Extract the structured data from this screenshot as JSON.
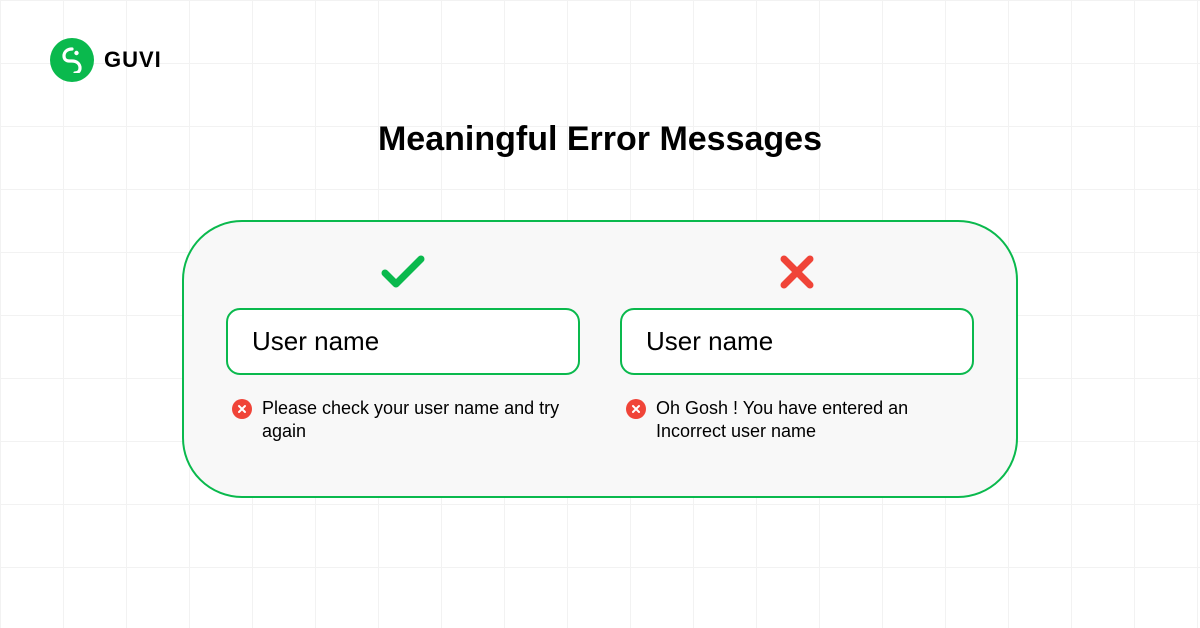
{
  "brand": {
    "name": "GUVI"
  },
  "title": "Meaningful Error Messages",
  "good": {
    "field_text": "User name",
    "error_text": "Please check your user name and try again"
  },
  "bad": {
    "field_text": "User name",
    "error_text": "Oh Gosh ! You have entered an Incorrect user name"
  },
  "colors": {
    "brand_green": "#0ab94d",
    "error_red": "#f04438"
  }
}
